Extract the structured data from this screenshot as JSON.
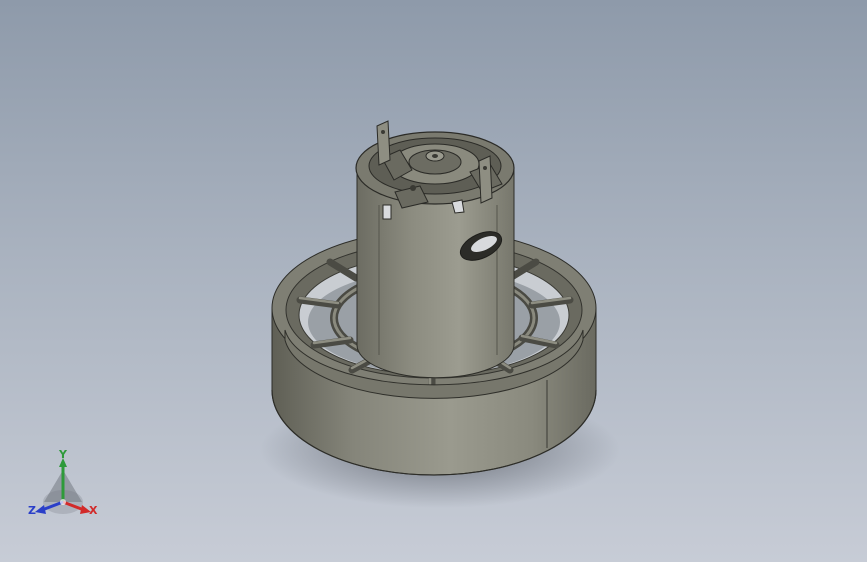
{
  "viewport": {
    "background_top": "#8e9aaa",
    "background_bottom": "#c7ccd6",
    "model_color": "#86867a"
  },
  "triad": {
    "x_label": "X",
    "y_label": "Y",
    "z_label": "Z",
    "x_color": "#d22a2a",
    "y_color": "#2e9a3a",
    "z_color": "#2a3fc9"
  }
}
